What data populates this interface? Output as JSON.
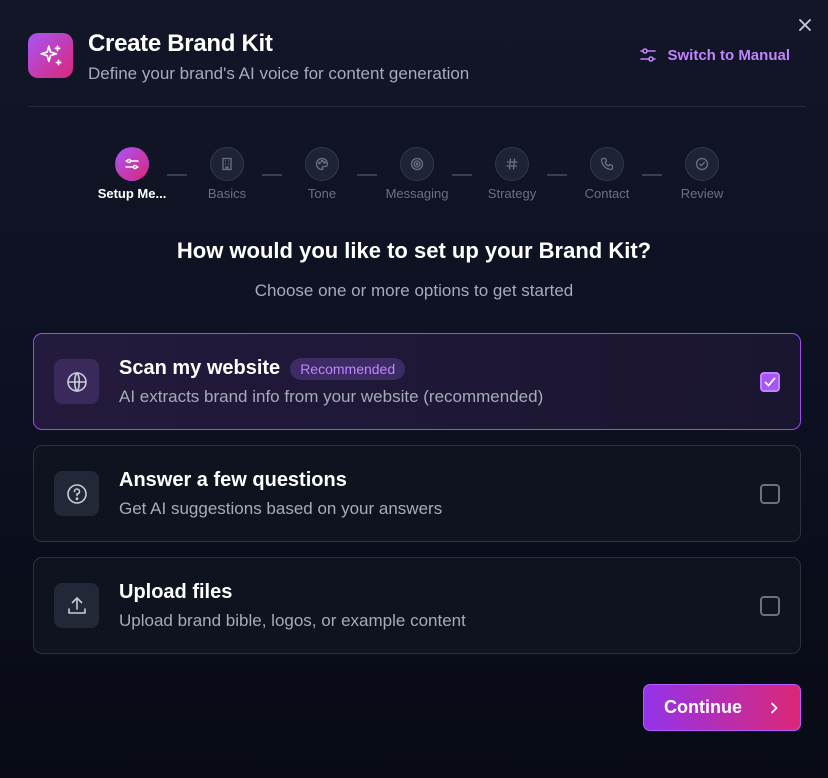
{
  "dialog": {
    "title": "Create Brand Kit",
    "subtitle": "Define your brand's AI voice for content generation",
    "switch_label": "Switch to Manual",
    "close_icon": "close-icon"
  },
  "colors": {
    "accent": "#a855f7",
    "accent_pink": "#db2777",
    "accent_text": "#c084fc",
    "background": "#0c1020"
  },
  "steps": [
    {
      "label": "Setup Me...",
      "icon": "sliders-icon",
      "active": true
    },
    {
      "label": "Basics",
      "icon": "building-icon",
      "active": false
    },
    {
      "label": "Tone",
      "icon": "palette-icon",
      "active": false
    },
    {
      "label": "Messaging",
      "icon": "target-icon",
      "active": false
    },
    {
      "label": "Strategy",
      "icon": "hash-icon",
      "active": false
    },
    {
      "label": "Contact",
      "icon": "phone-icon",
      "active": false
    },
    {
      "label": "Review",
      "icon": "check-circle-icon",
      "active": false
    }
  ],
  "question": "How would you like to set up your Brand Kit?",
  "hint": "Choose one or more options to get started",
  "options": [
    {
      "title": "Scan my website",
      "badge": "Recommended",
      "description": "AI extracts brand info from your website (recommended)",
      "icon": "globe-icon",
      "checked": true
    },
    {
      "title": "Answer a few questions",
      "description": "Get AI suggestions based on your answers",
      "icon": "question-circle-icon",
      "checked": false
    },
    {
      "title": "Upload files",
      "description": "Upload brand bible, logos, or example content",
      "icon": "upload-icon",
      "checked": false
    }
  ],
  "continue_label": "Continue"
}
